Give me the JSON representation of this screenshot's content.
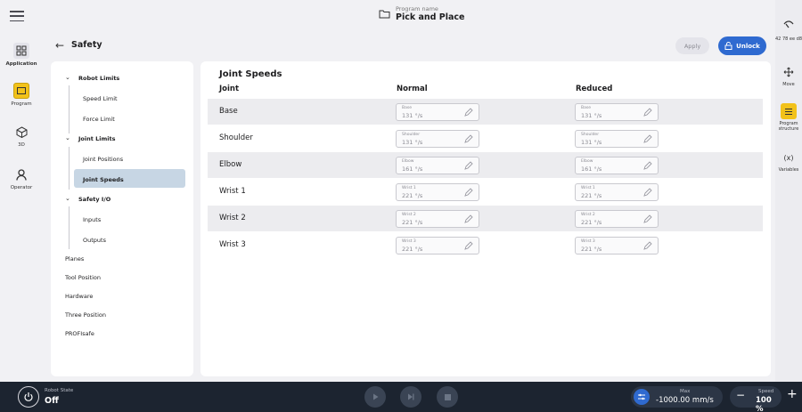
{
  "header": {
    "program_name_label": "Program name",
    "program_name": "Pick and Place"
  },
  "left_rail": [
    {
      "label": "Application",
      "icon": "grid-icon"
    },
    {
      "label": "Program",
      "icon": "program-icon"
    },
    {
      "label": "3D",
      "icon": "cube-icon"
    },
    {
      "label": "Operator",
      "icon": "person-icon"
    }
  ],
  "right_rail": [
    {
      "label": "",
      "icon": "pointer-icon"
    },
    {
      "label": "42 78 ee d8",
      "icon": ""
    },
    {
      "label": "Move",
      "icon": "move-icon"
    },
    {
      "label": "Program structure",
      "icon": "list-icon"
    },
    {
      "label": "Variables",
      "icon": "variable-icon"
    }
  ],
  "page": {
    "title": "Safety",
    "apply_label": "Apply",
    "unlock_label": "Unlock"
  },
  "nav": {
    "robot_limits": "Robot Limits",
    "speed_limit": "Speed Limit",
    "force_limit": "Force Limit",
    "joint_limits": "Joint Limits",
    "joint_positions": "Joint Positions",
    "joint_speeds": "Joint Speeds",
    "safety_io": "Safety I/O",
    "inputs": "Inputs",
    "outputs": "Outputs",
    "planes": "Planes",
    "tool_position": "Tool Position",
    "hardware": "Hardware",
    "three_position": "Three Position",
    "profisafe": "PROFIsafe"
  },
  "content": {
    "title": "Joint Speeds",
    "col_joint": "Joint",
    "col_normal": "Normal",
    "col_reduced": "Reduced",
    "rows": [
      {
        "joint": "Base",
        "normal": "131 °/s",
        "reduced": "131 °/s"
      },
      {
        "joint": "Shoulder",
        "normal": "131 °/s",
        "reduced": "131 °/s"
      },
      {
        "joint": "Elbow",
        "normal": "161 °/s",
        "reduced": "161 °/s"
      },
      {
        "joint": "Wrist 1",
        "normal": "221 °/s",
        "reduced": "221 °/s"
      },
      {
        "joint": "Wrist 2",
        "normal": "221 °/s",
        "reduced": "221 °/s"
      },
      {
        "joint": "Wrist 3",
        "normal": "221 °/s",
        "reduced": "221 °/s"
      }
    ]
  },
  "bottom": {
    "robot_state_label": "Robot State",
    "robot_state": "Off",
    "max_label": "Max",
    "max_value": "-1000.00 mm/s",
    "speed_label": "Speed",
    "speed_value": "100 %"
  },
  "colors": {
    "accent": "#2f6ad0",
    "active_yellow": "#f2c21a",
    "bottom_bar": "#1c2430",
    "nav_selected": "#c7d6e4"
  }
}
